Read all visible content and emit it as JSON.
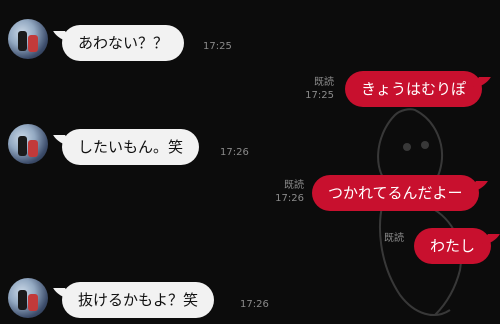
{
  "messages": [
    {
      "side": "in",
      "text": "あわない？？",
      "time": "17:25"
    },
    {
      "side": "out",
      "text": "きょうはむりぽ",
      "time": "17:25",
      "read": "既読"
    },
    {
      "side": "in",
      "text": "したいもん。笑",
      "time": "17:26"
    },
    {
      "side": "out",
      "text": "つかれてるんだよー",
      "time": "17:26",
      "read": "既読"
    },
    {
      "side": "out",
      "text": "わたし",
      "time": "",
      "read": "既読"
    },
    {
      "side": "in",
      "text": "抜けるかもよ？笑",
      "time": "17:26"
    }
  ],
  "colors": {
    "background": "#0c0c0c",
    "incoming_bubble": "#f2f2f2",
    "outgoing_bubble": "#c8102e",
    "meta_text": "#8a8a8a"
  }
}
